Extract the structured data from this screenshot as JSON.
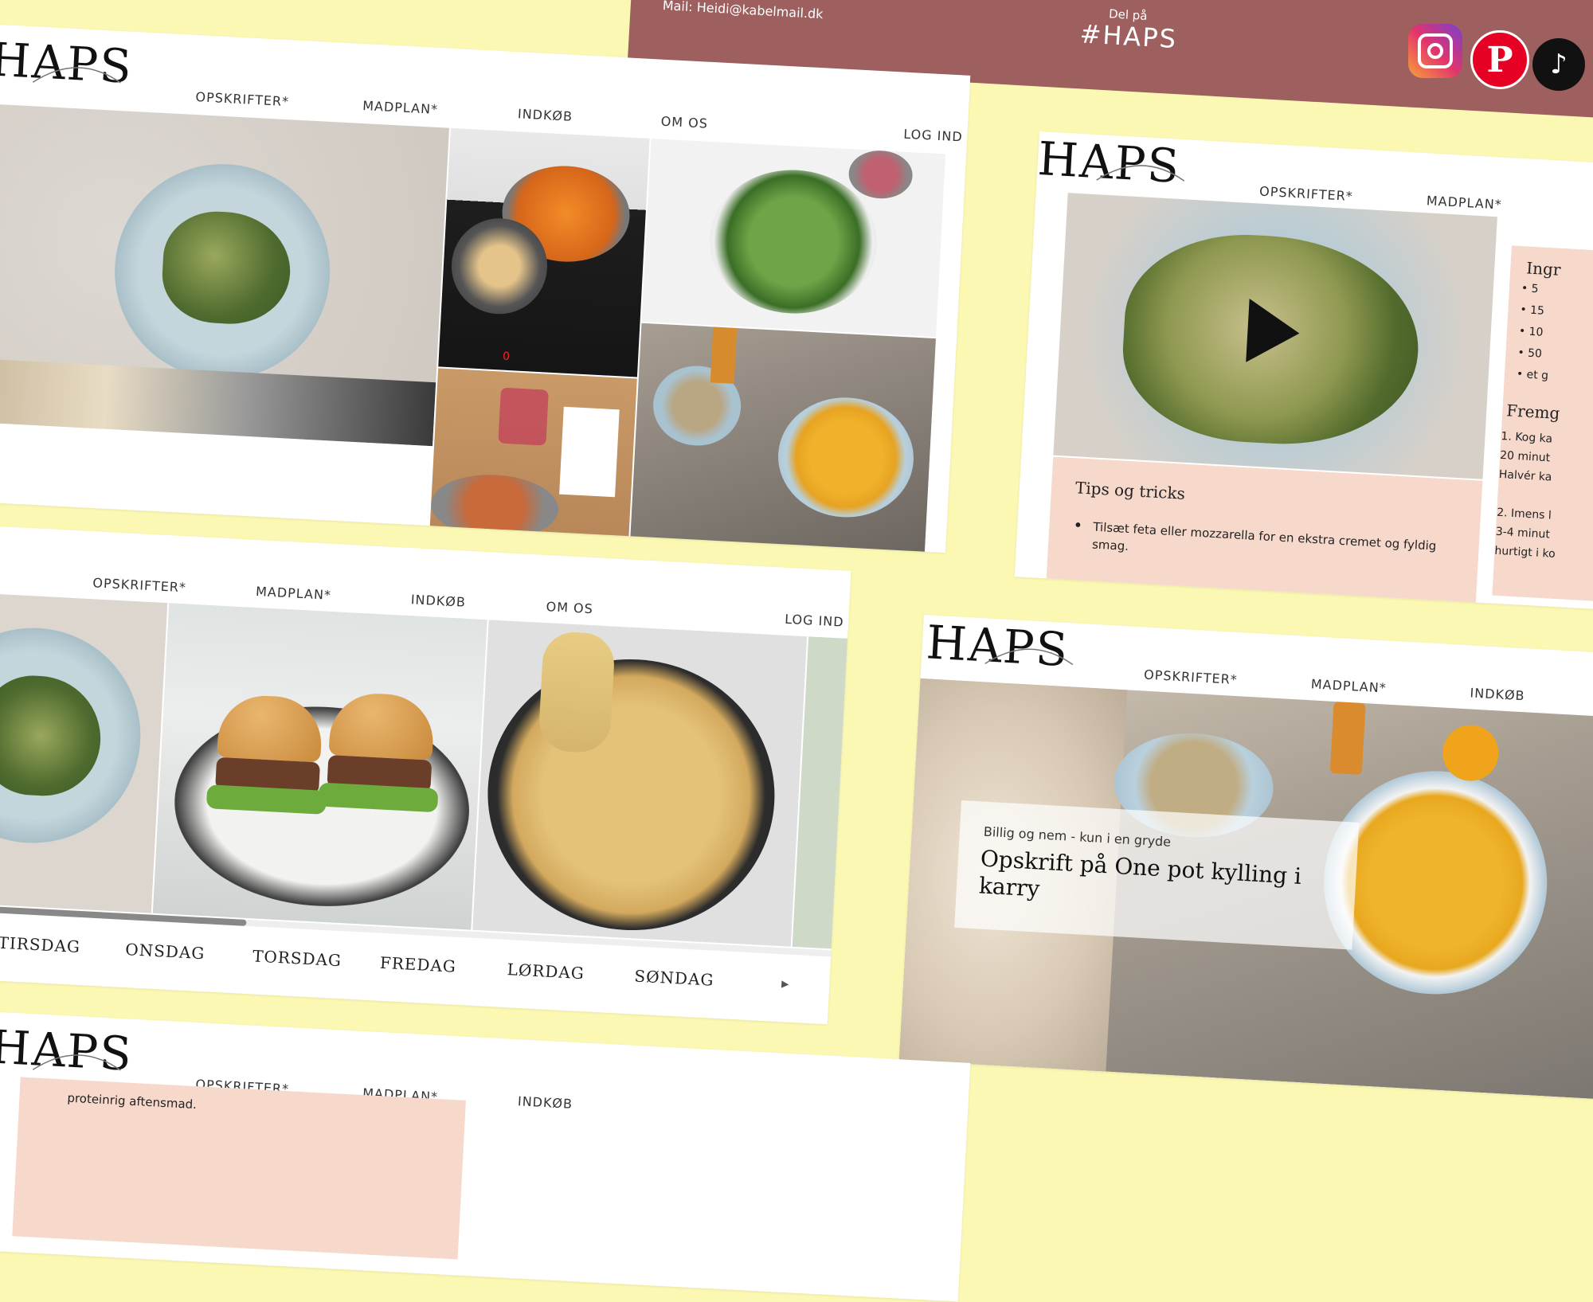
{
  "brand": {
    "logo": "HAPS"
  },
  "nav": {
    "recipes": "OPSKRIFTER*",
    "mealplan": "MADPLAN*",
    "shopping": "INDKØB",
    "about": "OM OS",
    "login": "LOG IND"
  },
  "footer": {
    "mail": "Mail: Heidi@kabelmail.dk",
    "share_label": "Del på",
    "hashtag": "#HAPS",
    "socials": [
      {
        "name": "Instagram",
        "icon": "instagram-icon"
      },
      {
        "name": "Pinterest",
        "icon": "pinterest-icon"
      },
      {
        "name": "TikTok",
        "icon": "tiktok-icon"
      }
    ]
  },
  "recipe_detail": {
    "tips_title": "Tips og tricks",
    "tips": [
      "Tilsæt feta eller mozzarella for en ekstra cremet og fyldig smag."
    ],
    "ingredients_title": "Ingr",
    "ingredient_items": [
      "5",
      "15",
      "10",
      "50",
      "et g"
    ],
    "method_title": "Fremg",
    "method_lines": [
      "1. Kog ka",
      "20 minut",
      "Halvér ka",
      "2. Imens l",
      "3-4 minut",
      "hurtigt i ko"
    ]
  },
  "mealplan": {
    "days": [
      "TIRSDAG",
      "ONSDAG",
      "TORSDAG",
      "FREDAG",
      "LØRDAG",
      "SØNDAG"
    ]
  },
  "featured": {
    "kicker": "Billig og nem - kun i en gryde",
    "title": "Opskrift på One pot kylling i karry"
  },
  "snippet": {
    "text": "proteinrig aftensmad."
  },
  "colors": {
    "background": "#fbf8b4",
    "footer": "#9e5f5f",
    "accent_box": "#f7d9cc"
  }
}
